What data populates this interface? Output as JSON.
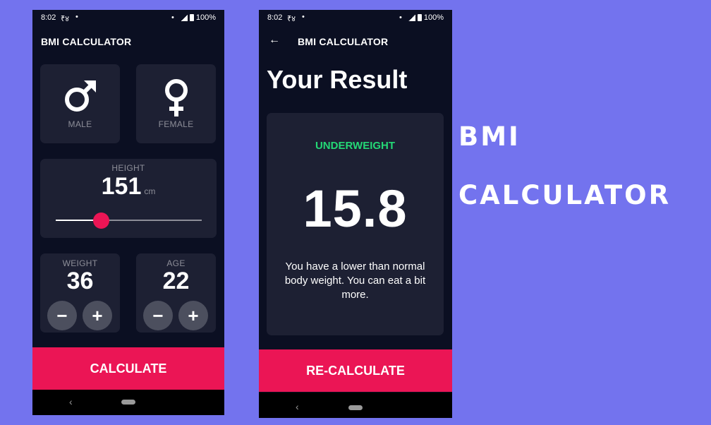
{
  "screen1": {
    "status": {
      "time": "8:02",
      "symbol": "₹४",
      "dot": "•",
      "battery": "100%"
    },
    "title": "BMI CALCULATOR",
    "male_label": "MALE",
    "female_label": "FEMALE",
    "height": {
      "label": "HEIGHT",
      "value": "151",
      "unit": "cm",
      "slider_fraction": 0.3
    },
    "weight": {
      "label": "WEIGHT",
      "value": "36"
    },
    "age": {
      "label": "AGE",
      "value": "22"
    },
    "minus": "−",
    "plus": "+",
    "calculate_label": "CALCULATE",
    "nav_back": "‹"
  },
  "screen2": {
    "status": {
      "time": "8:02",
      "symbol": "₹४",
      "dot": "•",
      "battery": "100%"
    },
    "title": "BMI CALCULATOR",
    "back_arrow": "←",
    "heading": "Your Result",
    "status_text": "UNDERWEIGHT",
    "bmi_value": "15.8",
    "description": "You have a lower than normal body weight. You can eat a bit more.",
    "recalculate_label": "RE-CALCULATE",
    "nav_back": "‹"
  },
  "promo": {
    "line1": "BMI",
    "line2": "CALCULATOR"
  },
  "colors": {
    "background": "#7373ee",
    "screen": "#0b0f22",
    "card": "#1d2033",
    "accent": "#eb1555",
    "result_green": "#24d876",
    "muted": "#8d8e98"
  },
  "icons": [
    "male-icon",
    "female-icon",
    "back-arrow-icon",
    "minus-icon",
    "plus-icon",
    "signal-icon",
    "battery-icon"
  ]
}
